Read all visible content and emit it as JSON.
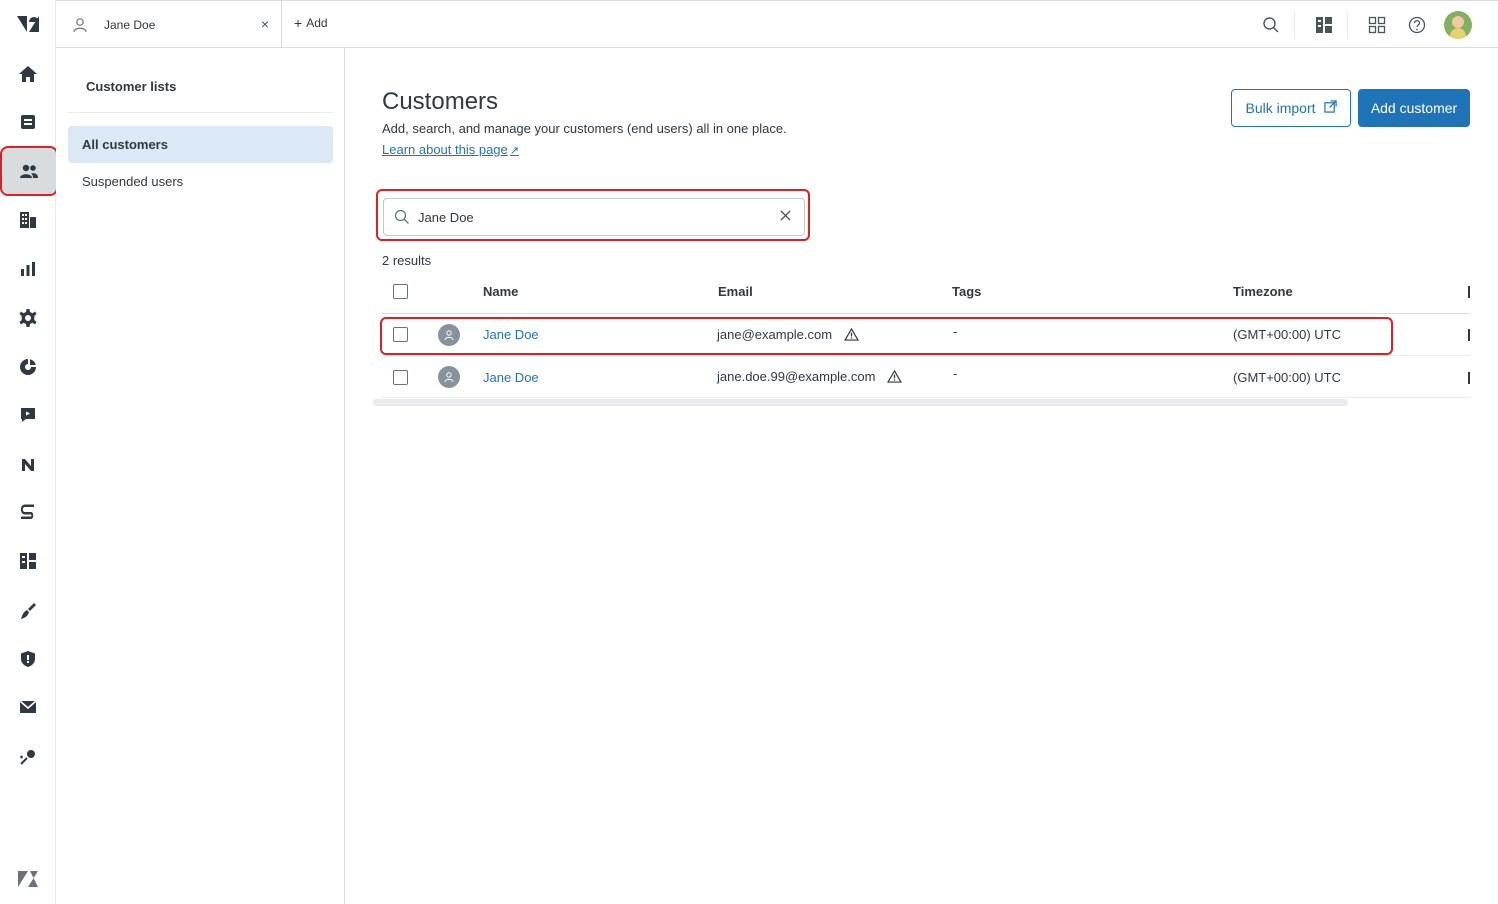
{
  "topbar": {
    "tab_label": "Jane Doe",
    "tab_close": "×",
    "add_label": "Add",
    "add_plus": "+"
  },
  "nav_icons": [
    "zendesk-logo",
    "home-icon",
    "views-icon",
    "customers-icon",
    "organizations-icon",
    "reporting-icon",
    "admin-gear-icon",
    "explore-icon",
    "chat-icon",
    "n-app-icon",
    "s-app-icon",
    "apps-icon",
    "broom-icon",
    "shield-icon",
    "mail-icon",
    "sparkle-icon",
    "zendesk-product-icon"
  ],
  "sidebar": {
    "title": "Customer lists",
    "items": [
      {
        "label": "All customers"
      },
      {
        "label": "Suspended users"
      }
    ]
  },
  "main": {
    "title": "Customers",
    "subtitle": "Add, search, and manage your customers (end users) all in one place.",
    "learn_link": "Learn about this page",
    "bulk_import": "Bulk import",
    "add_customer": "Add customer",
    "search_value": "Jane Doe",
    "results_count": "2 results"
  },
  "table": {
    "columns": [
      "Name",
      "Email",
      "Tags",
      "Timezone"
    ],
    "rows": [
      {
        "name": "Jane Doe",
        "email": "jane@example.com",
        "tags": "-",
        "timezone": "(GMT+00:00) UTC"
      },
      {
        "name": "Jane Doe",
        "email": "jane.doe.99@example.com",
        "tags": "-",
        "timezone": "(GMT+00:00) UTC"
      }
    ]
  },
  "colors": {
    "accent": "#1f73b7",
    "highlight": "#e02020",
    "selected_bg": "#dbe9f7"
  }
}
